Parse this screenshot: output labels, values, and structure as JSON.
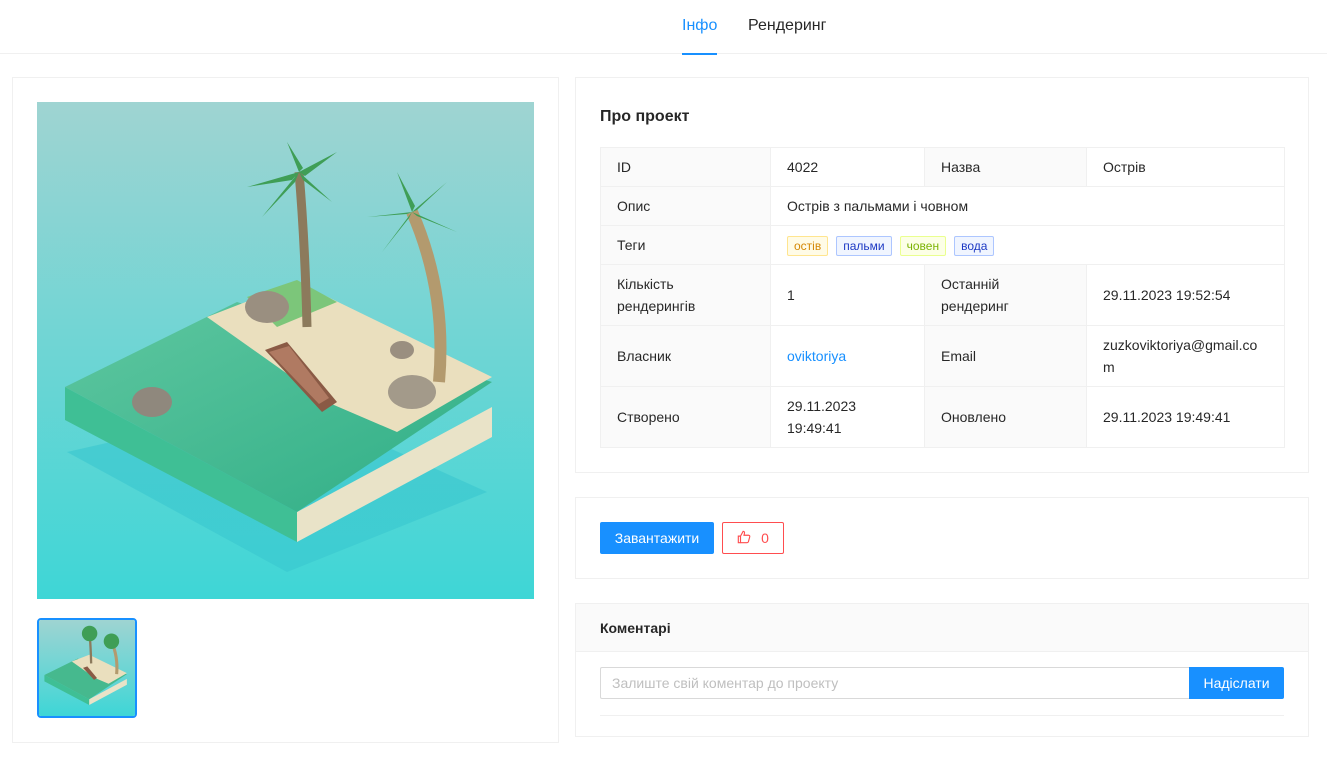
{
  "tabs": {
    "info": "Інфо",
    "render": "Рендеринг"
  },
  "about": {
    "title": "Про проект",
    "rows": {
      "id_label": "ID",
      "id_value": "4022",
      "name_label": "Назва",
      "name_value": "Острів",
      "desc_label": "Опис",
      "desc_value": "Острів з пальмами і човном",
      "tags_label": "Теги",
      "tags": [
        "остів",
        "пальми",
        "човен",
        "вода"
      ],
      "renders_label": "Кількість рендерингів",
      "renders_value": "1",
      "last_render_label": "Останній рендеринг",
      "last_render_value": "29.11.2023 19:52:54",
      "owner_label": "Власник",
      "owner_value": "oviktoriya",
      "email_label": "Email",
      "email_value": "zuzkoviktoriya@gmail.com",
      "created_label": "Створено",
      "created_value": "29.11.2023 19:49:41",
      "updated_label": "Оновлено",
      "updated_value": "29.11.2023 19:49:41"
    }
  },
  "actions": {
    "download": "Завантажити",
    "likes": "0"
  },
  "comments": {
    "title": "Коментарі",
    "placeholder": "Залиште свій коментар до проекту",
    "send": "Надіслати"
  },
  "colors": {
    "accent": "#1890ff",
    "like": "#ff4d4f"
  }
}
